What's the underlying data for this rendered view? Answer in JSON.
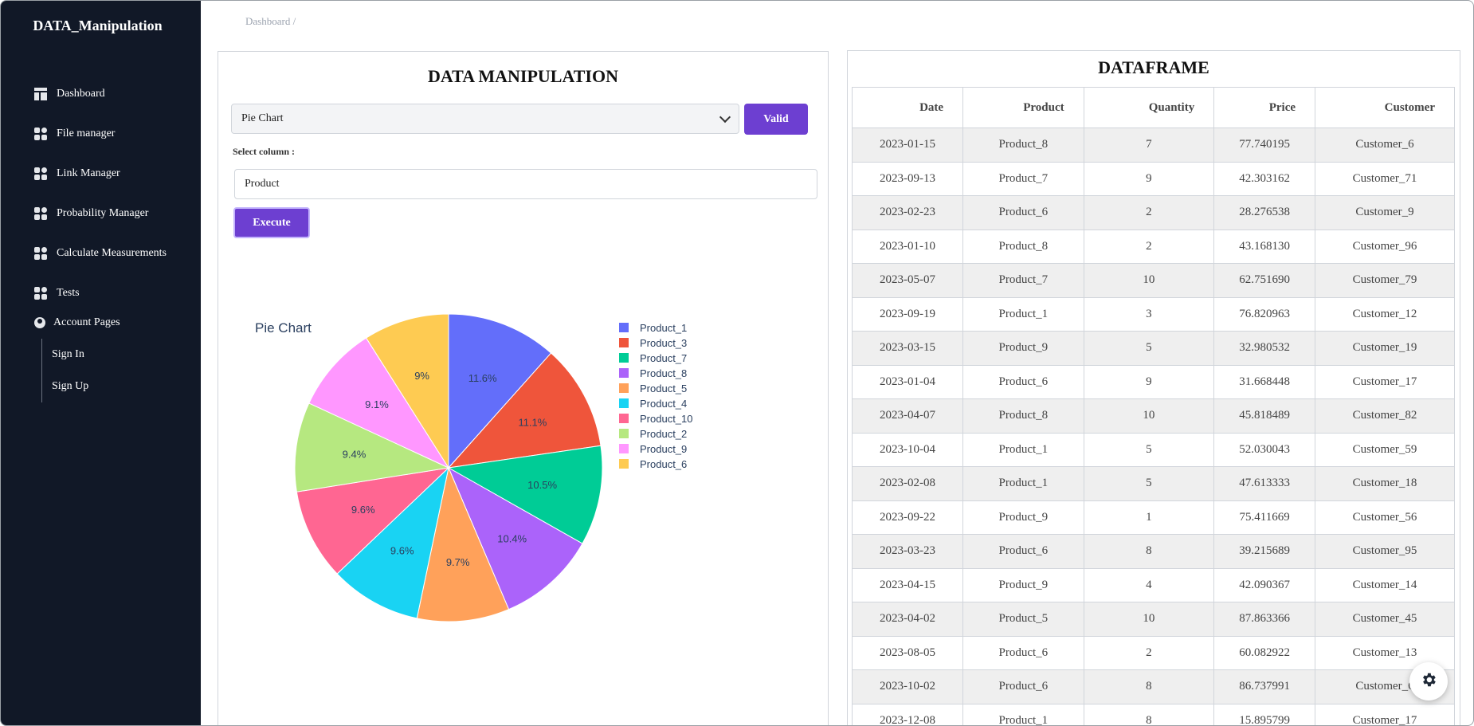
{
  "app": {
    "brand": "DATA_Manipulation"
  },
  "sidebar": {
    "items": [
      {
        "label": "Dashboard",
        "icon": "dashboard-icon"
      },
      {
        "label": "File manager",
        "icon": "grid-icon"
      },
      {
        "label": "Link Manager",
        "icon": "grid-icon"
      },
      {
        "label": "Probability Manager",
        "icon": "grid-icon"
      },
      {
        "label": "Calculate Measurements",
        "icon": "grid-icon"
      },
      {
        "label": "Tests",
        "icon": "grid-icon"
      }
    ],
    "account": {
      "label": "Account Pages",
      "icon": "user-circle-icon",
      "sub": [
        {
          "label": "Sign In"
        },
        {
          "label": "Sign Up"
        }
      ]
    }
  },
  "breadcrumb": {
    "text": "Dashboard  /"
  },
  "left_panel": {
    "title": "DATA MANIPULATION",
    "chart_select": {
      "value": "Pie Chart"
    },
    "valid_label": "Valid",
    "select_column_label": "Select column :",
    "column_value": "Product",
    "execute_label": "Execute"
  },
  "chart_data": {
    "type": "pie",
    "title": "Pie Chart",
    "labels": [
      "Product_1",
      "Product_3",
      "Product_7",
      "Product_8",
      "Product_5",
      "Product_4",
      "Product_10",
      "Product_2",
      "Product_9",
      "Product_6"
    ],
    "values": [
      11.6,
      11.1,
      10.5,
      10.4,
      9.7,
      9.6,
      9.6,
      9.4,
      9.1,
      9.0
    ],
    "slice_labels": [
      "11.6%",
      "11.1%",
      "10.5%",
      "10.4%",
      "9.7%",
      "9.6%",
      "9.6%",
      "9.4%",
      "9.1%",
      "9%"
    ],
    "colors": [
      "#636efa",
      "#ef553b",
      "#00cc96",
      "#ab63fa",
      "#ffa15a",
      "#19d3f3",
      "#ff6692",
      "#b6e880",
      "#ff97ff",
      "#fecb52"
    ],
    "direction": "clockwise",
    "legend_position": "right"
  },
  "right_panel": {
    "title": "DATAFRAME",
    "columns": [
      "Date",
      "Product",
      "Quantity",
      "Price",
      "Customer"
    ],
    "rows": [
      [
        "2023-01-15",
        "Product_8",
        "7",
        "77.740195",
        "Customer_6"
      ],
      [
        "2023-09-13",
        "Product_7",
        "9",
        "42.303162",
        "Customer_71"
      ],
      [
        "2023-02-23",
        "Product_6",
        "2",
        "28.276538",
        "Customer_9"
      ],
      [
        "2023-01-10",
        "Product_8",
        "2",
        "43.168130",
        "Customer_96"
      ],
      [
        "2023-05-07",
        "Product_7",
        "10",
        "62.751690",
        "Customer_79"
      ],
      [
        "2023-09-19",
        "Product_1",
        "3",
        "76.820963",
        "Customer_12"
      ],
      [
        "2023-03-15",
        "Product_9",
        "5",
        "32.980532",
        "Customer_19"
      ],
      [
        "2023-01-04",
        "Product_6",
        "9",
        "31.668448",
        "Customer_17"
      ],
      [
        "2023-04-07",
        "Product_8",
        "10",
        "45.818489",
        "Customer_82"
      ],
      [
        "2023-10-04",
        "Product_1",
        "5",
        "52.030043",
        "Customer_59"
      ],
      [
        "2023-02-08",
        "Product_1",
        "5",
        "47.613333",
        "Customer_18"
      ],
      [
        "2023-09-22",
        "Product_9",
        "1",
        "75.411669",
        "Customer_56"
      ],
      [
        "2023-03-23",
        "Product_6",
        "8",
        "39.215689",
        "Customer_95"
      ],
      [
        "2023-04-15",
        "Product_9",
        "4",
        "42.090367",
        "Customer_14"
      ],
      [
        "2023-04-02",
        "Product_5",
        "10",
        "87.863366",
        "Customer_45"
      ],
      [
        "2023-08-05",
        "Product_6",
        "2",
        "60.082922",
        "Customer_13"
      ],
      [
        "2023-10-02",
        "Product_6",
        "8",
        "86.737991",
        "Customer_6"
      ],
      [
        "2023-12-08",
        "Product_1",
        "8",
        "15.895799",
        "Customer_17"
      ]
    ]
  },
  "settings": {
    "icon": "gear-icon"
  }
}
